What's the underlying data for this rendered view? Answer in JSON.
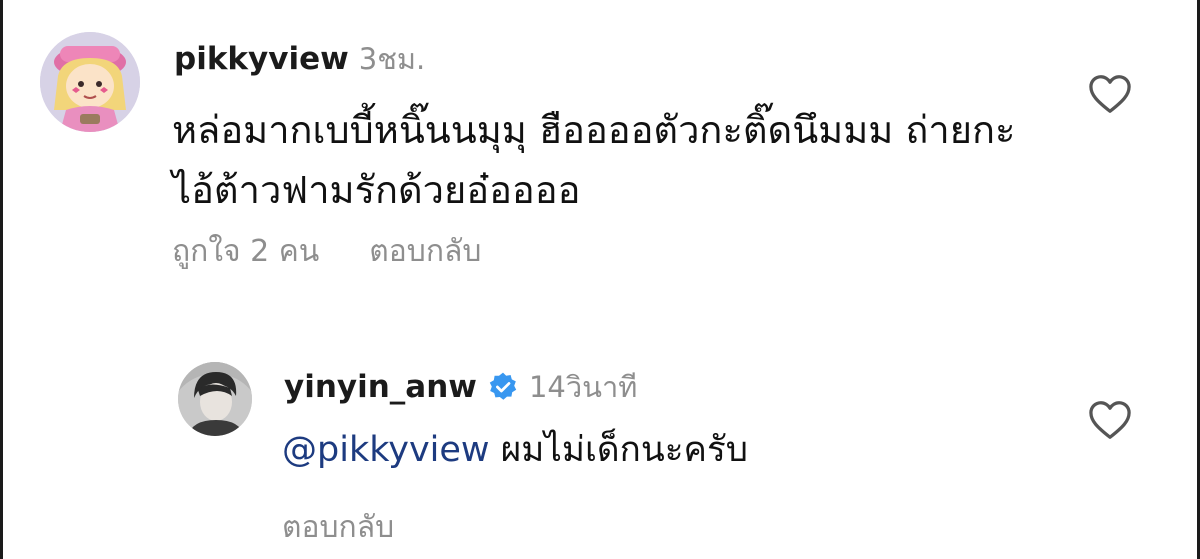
{
  "comments": [
    {
      "username": "pikkyview",
      "time": "3ชม.",
      "text": "หล่อมากเบบี้หนิ๊นนมุมุ ฮืออออตัวกะติ๊ดนึมมม ถ่ายกะไอ้ต้าวฟามรักด้วยอ๋ออออ",
      "likes": "ถูกใจ 2 คน",
      "reply_label": "ตอบกลับ",
      "avatar_icon": "cartoon-girl-avatar",
      "like_icon": "heart-outline-icon"
    },
    {
      "username": "yinyin_anw",
      "verified": true,
      "verified_icon": "verified-badge-icon",
      "time": "14วินาที",
      "mention": "@pikkyview",
      "text": "ผมไม่เด็กนะครับ",
      "reply_label": "ตอบกลับ",
      "avatar_icon": "profile-photo-avatar",
      "like_icon": "heart-outline-icon"
    }
  ],
  "colors": {
    "username": "#1b1b1b",
    "meta": "#8e8e8e",
    "mention": "#1d3b80",
    "verified": "#3897f0"
  }
}
